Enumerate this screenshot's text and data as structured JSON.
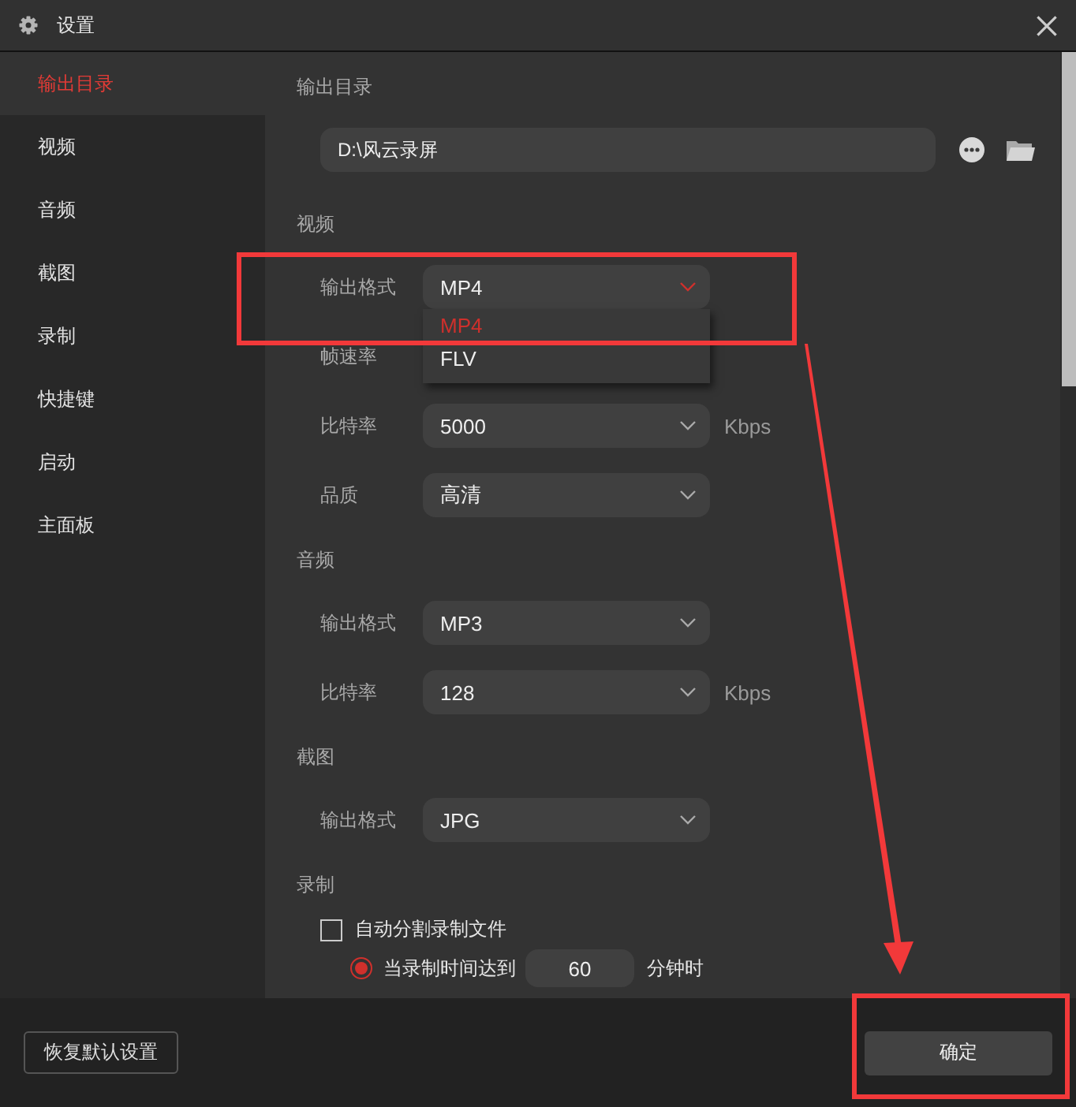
{
  "window": {
    "title": "设置"
  },
  "sidebar": {
    "items": [
      {
        "label": "输出目录",
        "selected": true
      },
      {
        "label": "视频",
        "selected": false
      },
      {
        "label": "音频",
        "selected": false
      },
      {
        "label": "截图",
        "selected": false
      },
      {
        "label": "录制",
        "selected": false
      },
      {
        "label": "快捷键",
        "selected": false
      },
      {
        "label": "启动",
        "selected": false
      },
      {
        "label": "主面板",
        "selected": false
      }
    ]
  },
  "content": {
    "sections": [
      {
        "heading": "输出目录",
        "rows": [
          {
            "kind": "path",
            "value": "D:\\风云录屏"
          }
        ]
      },
      {
        "heading": "视频",
        "rows": [
          {
            "kind": "select",
            "label": "输出格式",
            "value": "MP4",
            "expanded": true,
            "options": [
              {
                "label": "MP4",
                "selected": true
              },
              {
                "label": "FLV",
                "selected": false
              }
            ]
          },
          {
            "kind": "select",
            "label": "帧速率"
          },
          {
            "kind": "select",
            "label": "比特率",
            "value": "5000",
            "unit": "Kbps",
            "expanded": false
          },
          {
            "kind": "select",
            "label": "品质",
            "value": "高清",
            "expanded": false
          }
        ]
      },
      {
        "heading": "音频",
        "rows": [
          {
            "kind": "select",
            "label": "输出格式",
            "value": "MP3",
            "expanded": false
          },
          {
            "kind": "select",
            "label": "比特率",
            "value": "128",
            "unit": "Kbps",
            "expanded": false
          }
        ]
      },
      {
        "heading": "截图",
        "rows": [
          {
            "kind": "select",
            "label": "输出格式",
            "value": "JPG",
            "expanded": false
          }
        ]
      },
      {
        "heading": "录制",
        "rows": [
          {
            "kind": "checkbox",
            "label": "自动分割录制文件",
            "checked": false
          },
          {
            "kind": "radio",
            "label": "当录制时间达到",
            "selected": true,
            "value": "60",
            "unit": "分钟时"
          }
        ]
      }
    ]
  },
  "footer": {
    "reset_button": "恢复默认设置",
    "confirm_button": "确定"
  },
  "annotations": [
    {
      "kind": "frame"
    },
    {
      "kind": "arrow"
    },
    {
      "kind": "frame"
    }
  ]
}
